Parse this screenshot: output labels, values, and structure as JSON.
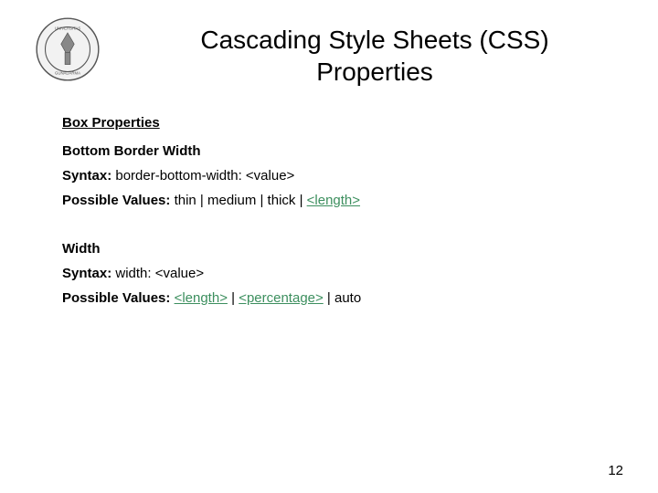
{
  "title_line1": "Cascading Style Sheets (CSS)",
  "title_line2": "Properties",
  "section_heading": "Box Properties",
  "prop1": {
    "name": "Bottom Border Width",
    "syntax_label": "Syntax:",
    "syntax_value": "border-bottom-width: <value>",
    "values_label": "Possible Values:",
    "values_prefix": "thin | medium | thick | ",
    "values_link1": "<length>"
  },
  "prop2": {
    "name": "Width",
    "syntax_label": "Syntax:",
    "syntax_value": "width: <value>",
    "values_label": "Possible Values:",
    "values_link1": "<length>",
    "values_sep1": " | ",
    "values_link2": "<percentage>",
    "values_suffix": " | auto"
  },
  "page_number": "12"
}
